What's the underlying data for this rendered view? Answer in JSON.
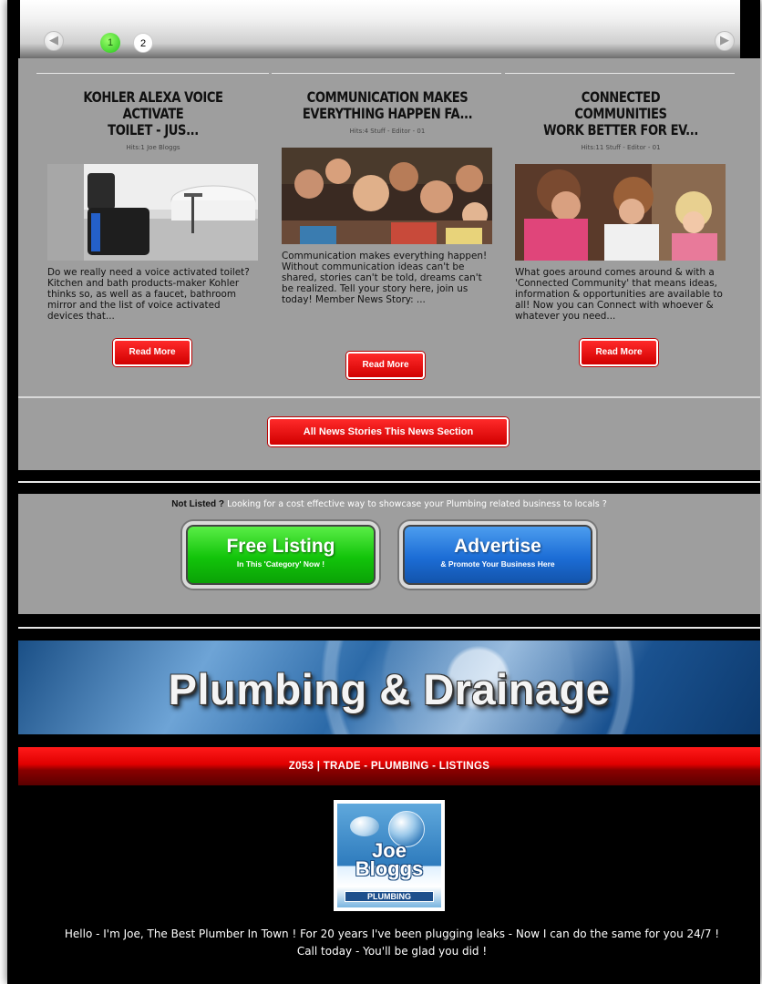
{
  "pager": {
    "pages": [
      "1",
      "2"
    ],
    "active": "1",
    "prev_icon": "arrow-left-icon",
    "next_icon": "arrow-right-icon"
  },
  "news": {
    "cards": [
      {
        "title": "KOHLER ALEXA VOICE ACTIVATE\nTOILET - JUS...",
        "author": "Hits:1 Joe Bloggs",
        "text": "Do we really need a voice activated toilet? Kitchen and bath products-maker Kohler thinks so, as well as a faucet, bathroom mirror and the list of voice activated devices that...",
        "button": "Read More"
      },
      {
        "title": "COMMUNICATION MAKES\nEVERYTHING HAPPEN FA...",
        "author": "Hits:4 Stuff - Editor - 01",
        "text": "Communication makes everything happen! Without communication ideas can't be shared, stories can't be told, dreams can't be realized. Tell your story here, join us today! Member News Story: ...",
        "button": "Read More"
      },
      {
        "title": "CONNECTED COMMUNITIES\nWORK BETTER FOR EV...",
        "author": "Hits:11 Stuff - Editor - 01",
        "text": "What goes around comes around & with a 'Connected Community' that means ideas, information & opportunities are available to all! Now you can Connect with whoever & whatever you need...",
        "button": "Read More"
      }
    ],
    "all_button": "All News Stories This News Section"
  },
  "promo": {
    "lead": "Not Listed ?",
    "text": "Looking for a cost effective way to showcase your Plumbing related business to locals ?",
    "free": {
      "main": "Free Listing",
      "sub": "In This 'Category' Now !"
    },
    "advertise": {
      "main": "Advertise",
      "sub": "& Promote Your Business Here"
    }
  },
  "banner": {
    "title": "Plumbing & Drainage"
  },
  "category_bar": "Z053 | TRADE - PLUMBING - LISTINGS",
  "logo": {
    "name": "Joe\nBloggs",
    "tag": "PLUMBING"
  },
  "intro": "Hello - I'm Joe, The Best Plumber In Town ! For 20 years I've been plugging leaks - Now I can do the same for you 24/7 ! Call today - You'll be glad you did !"
}
